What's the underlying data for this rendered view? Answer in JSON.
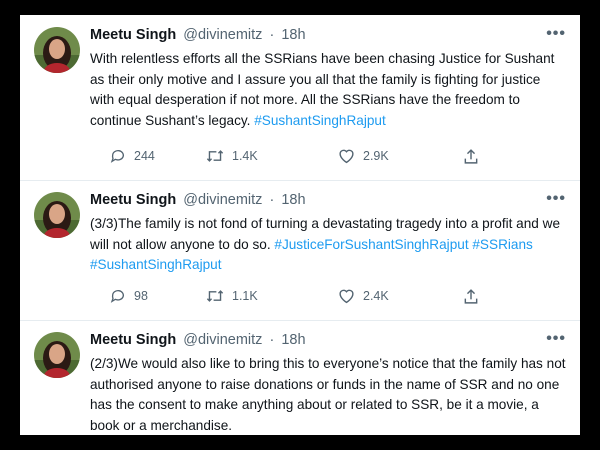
{
  "tweets": [
    {
      "name": "Meetu Singh",
      "handle": "@divinemitz",
      "separator": "·",
      "time": "18h",
      "more": "•••",
      "text": "With relentless efforts all the SSRians have been chasing Justice for Sushant as their only motive and I assure you all that the family is fighting for justice with equal desperation if not more. All the SSRians have the freedom to continue Sushant’s legacy. ",
      "hashtags": [
        "#SushantSinghRajput"
      ],
      "replies": "244",
      "retweets": "1.4K",
      "likes": "2.9K"
    },
    {
      "name": "Meetu Singh",
      "handle": "@divinemitz",
      "separator": "·",
      "time": "18h",
      "more": "•••",
      "text": "(3/3)The family is not fond of turning a devastating tragedy into a profit and we will not allow anyone to do so. ",
      "hashtags": [
        "#JusticeForSushantSinghRajput",
        "#SSRians",
        "#SushantSinghRajput"
      ],
      "replies": "98",
      "retweets": "1.1K",
      "likes": "2.4K"
    },
    {
      "name": "Meetu Singh",
      "handle": "@divinemitz",
      "separator": "·",
      "time": "18h",
      "more": "•••",
      "text": "(2/3)We would also like to bring this to everyone’s notice that the family has not authorised anyone to raise donations or funds in the name of SSR and no one has the consent to make anything about or related to SSR, be it a movie, a book or a merchandise."
    }
  ],
  "icons": {
    "reply": "reply-icon",
    "retweet": "retweet-icon",
    "like": "heart-icon",
    "share": "share-icon"
  },
  "colors": {
    "link": "#1d9bf0",
    "muted": "#536471",
    "frame_border": "#000000"
  }
}
